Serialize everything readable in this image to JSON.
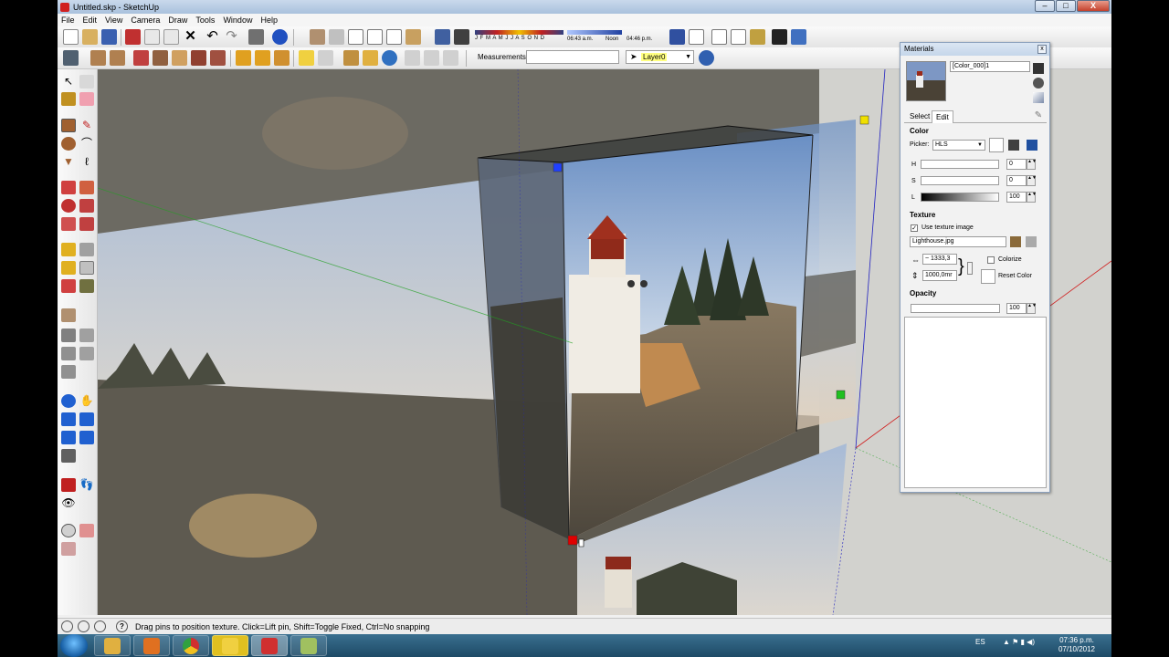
{
  "window": {
    "title": "Untitled.skp - SketchUp",
    "min": "–",
    "max": "□",
    "close": "X"
  },
  "menu": [
    "File",
    "Edit",
    "View",
    "Camera",
    "Draw",
    "Tools",
    "Window",
    "Help"
  ],
  "shadow": {
    "months": "J F M A M J J A S O N D",
    "time_start": "06:43 a.m.",
    "time_mid": "Noon",
    "time_end": "04:46 p.m."
  },
  "measurements": {
    "label": "Measurements",
    "value": ""
  },
  "layer": {
    "value": "Layer0"
  },
  "status": {
    "message": "Drag pins to position texture.  Click=Lift pin, Shift=Toggle Fixed, Ctrl=No snapping",
    "help_glyph": "?"
  },
  "materials": {
    "title": "Materials",
    "close": "x",
    "material_name": "[Color_000]1",
    "tabs": [
      "Select",
      "Edit"
    ],
    "color_heading": "Color",
    "picker_label": "Picker:",
    "picker_value": "HLS",
    "h_label": "H",
    "h_value": "0",
    "s_label": "S",
    "s_value": "0",
    "l_label": "L",
    "l_value": "100",
    "texture_heading": "Texture",
    "use_texture_label": "Use texture image",
    "use_texture_checked": "✓",
    "texture_file": "Lighthouse.jpg",
    "width_value": "~ 1333,3",
    "height_value": "1000,0mr",
    "colorize_label": "Colorize",
    "reset_color_label": "Reset Color",
    "opacity_heading": "Opacity",
    "opacity_value": "100"
  },
  "taskbar": {
    "language": "ES",
    "time": "07:36 p.m.",
    "date": "07/10/2012"
  },
  "colors": {
    "axis_red": "#d02020",
    "axis_green": "#20a020",
    "axis_blue": "#2020c0",
    "pin_red": "#e00000",
    "pin_green": "#20c020",
    "pin_yellow": "#f0e000",
    "pin_blue": "#2040ff"
  }
}
